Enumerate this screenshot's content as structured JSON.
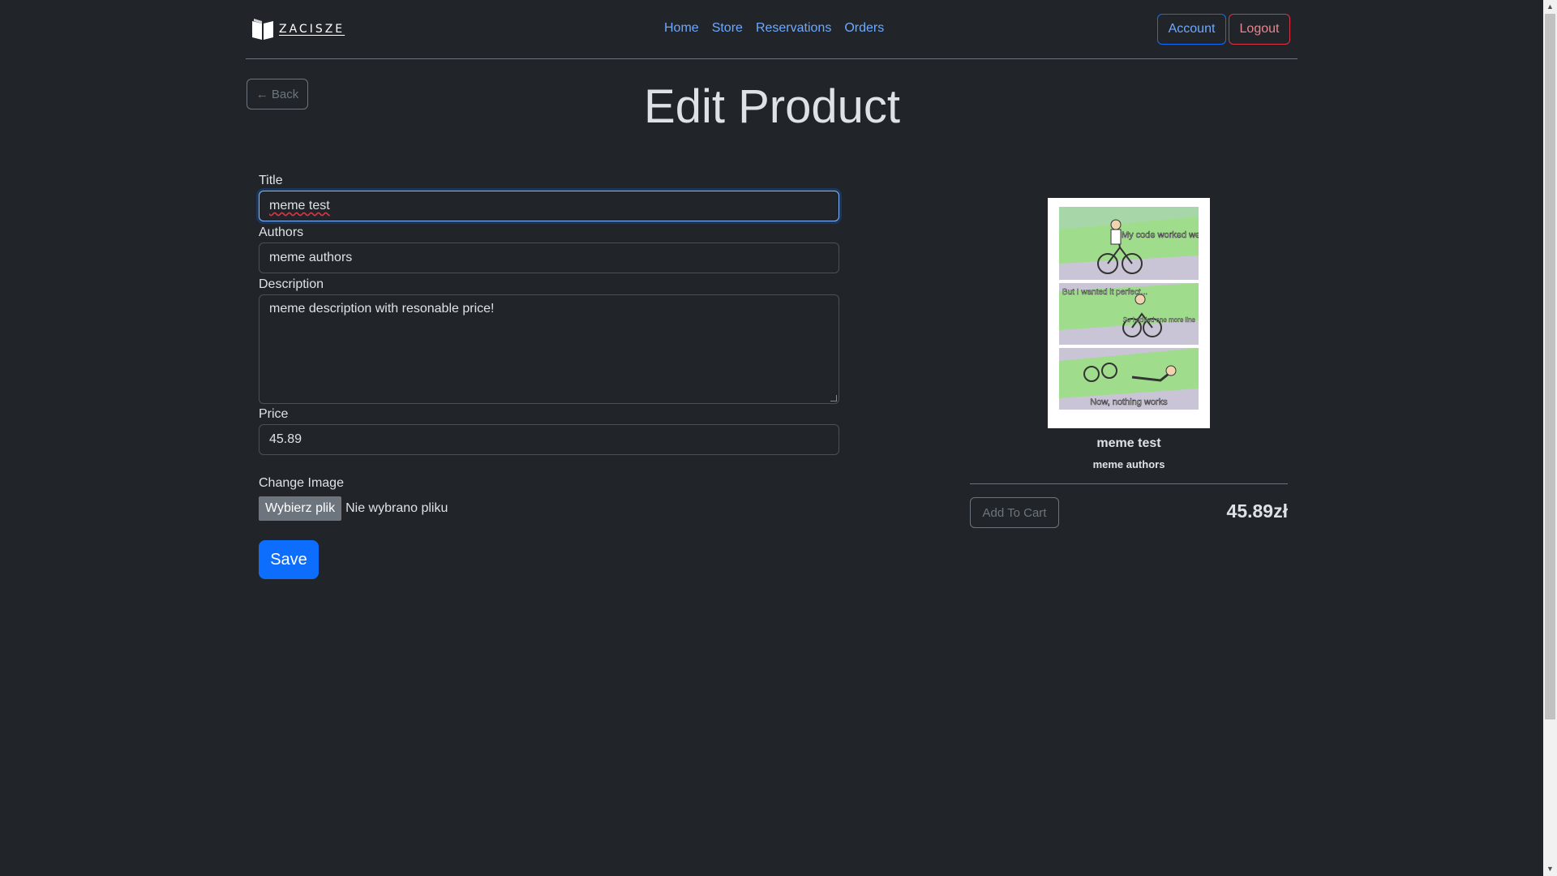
{
  "header": {
    "logo_text": "ZACISZE",
    "nav": [
      "Home",
      "Store",
      "Reservations",
      "Orders"
    ],
    "account_label": "Account",
    "logout_label": "Logout"
  },
  "page": {
    "back_label": "← Back",
    "title": "Edit Product"
  },
  "form": {
    "title_label": "Title",
    "title_value": "meme test",
    "authors_label": "Authors",
    "authors_value": "meme authors",
    "description_label": "Description",
    "description_value": "meme description with resonable price!",
    "price_label": "Price",
    "price_value": "45.89",
    "image_label": "Change Image",
    "file_button": "Wybierz plik",
    "file_status": "Nie wybrano pliku",
    "save_label": "Save"
  },
  "preview": {
    "title": "meme test",
    "authors": "meme authors",
    "cart_label": "Add To Cart",
    "price": "45.89zł",
    "meme_captions": [
      "My code worked well",
      "But I wanted it perfect...",
      "So I added one more line",
      "Now, nothing works"
    ]
  },
  "colors": {
    "background": "#212529",
    "primary": "#0d6efd",
    "link": "#6ea8fe",
    "danger": "#dc3545"
  }
}
